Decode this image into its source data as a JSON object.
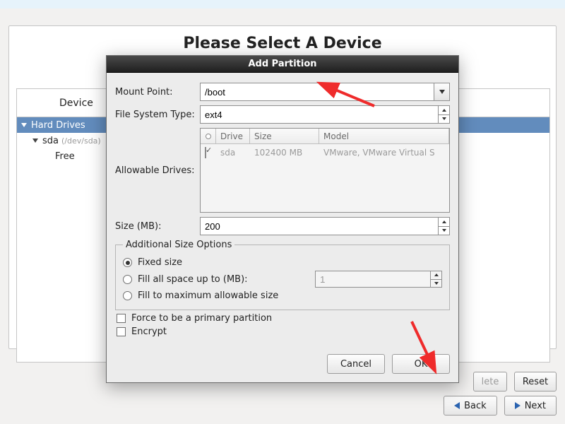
{
  "page": {
    "main_title": "Please Select A Device",
    "device_header": "Device",
    "tree": {
      "hard_drives": "Hard Drives",
      "sda": "sda",
      "sda_path": "(/dev/sda)",
      "free": "Free"
    }
  },
  "dialog": {
    "title": "Add Partition",
    "labels": {
      "mount_point": "Mount Point:",
      "fs_type": "File System Type:",
      "allowable": "Allowable Drives:",
      "size": "Size (MB):",
      "additional": "Additional Size Options",
      "fixed": "Fixed size",
      "fill_up": "Fill all space up to (MB):",
      "fill_max": "Fill to maximum allowable size",
      "force_primary": "Force to be a primary partition",
      "encrypt": "Encrypt"
    },
    "values": {
      "mount_point": "/boot",
      "fs_type": "ext4",
      "size": "200",
      "fill_up_val": "1"
    },
    "drives": {
      "cols": {
        "drive": "Drive",
        "size": "Size",
        "model": "Model"
      },
      "row": {
        "drive": "sda",
        "size": "102400 MB",
        "model": "VMware, VMware Virtual S"
      }
    },
    "buttons": {
      "cancel": "Cancel",
      "ok": "OK"
    }
  },
  "footer": {
    "delete": "lete",
    "reset": "Reset",
    "back": "Back",
    "next": "Next"
  }
}
